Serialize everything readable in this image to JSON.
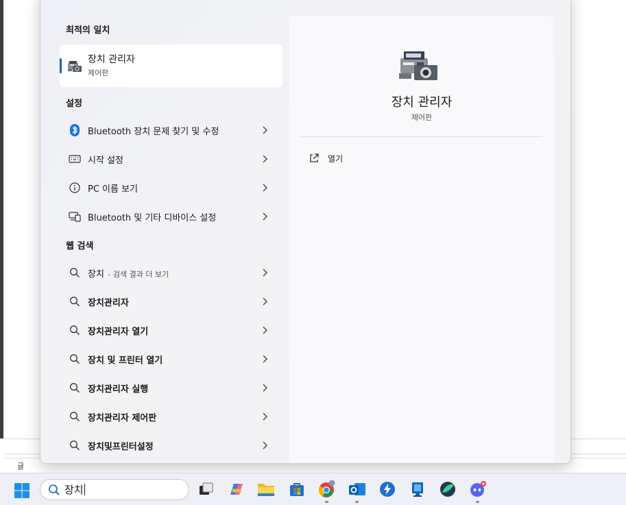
{
  "status_bar": {
    "text": "글"
  },
  "search_panel": {
    "best_match": {
      "heading": "최적의 일치",
      "title": "장치 관리자",
      "subtitle": "제어판"
    },
    "settings": {
      "heading": "설정",
      "items": [
        {
          "label": "Bluetooth 장치 문제 찾기 및 수정",
          "icon": "bluetooth-icon"
        },
        {
          "label": "시작 설정",
          "icon": "keyboard-icon"
        },
        {
          "label": "PC 이름 보기",
          "icon": "info-icon"
        },
        {
          "label": "Bluetooth 및 기타 디바이스 설정",
          "icon": "devices-icon"
        }
      ]
    },
    "web_search": {
      "heading": "웹 검색",
      "items": [
        {
          "label": "장치",
          "suffix": " - 검색 결과 더 보기",
          "icon": "search-icon"
        },
        {
          "label": "장치관리자",
          "icon": "search-icon"
        },
        {
          "label": "장치관리자 열기",
          "icon": "search-icon"
        },
        {
          "label": "장치 및 프린터 열기",
          "icon": "search-icon"
        },
        {
          "label": "장치관리자 실행",
          "icon": "search-icon"
        },
        {
          "label": "장치관리자 제어판",
          "icon": "search-icon"
        },
        {
          "label": "장치및프린터설정",
          "icon": "search-icon"
        }
      ]
    },
    "detail": {
      "title": "장치 관리자",
      "subtitle": "제어판",
      "action_label": "열기",
      "action_icon": "open-external-icon"
    },
    "accent_color": "#0067c0"
  },
  "taskbar": {
    "search_value": "장치",
    "apps": [
      "start-icon",
      "task-view-icon",
      "copilot-icon",
      "file-explorer-icon",
      "store-icon",
      "chrome-icon",
      "outlook-icon",
      "app-bolt-icon",
      "app-blue-doc-icon",
      "app-green-icon",
      "discord-icon"
    ]
  }
}
